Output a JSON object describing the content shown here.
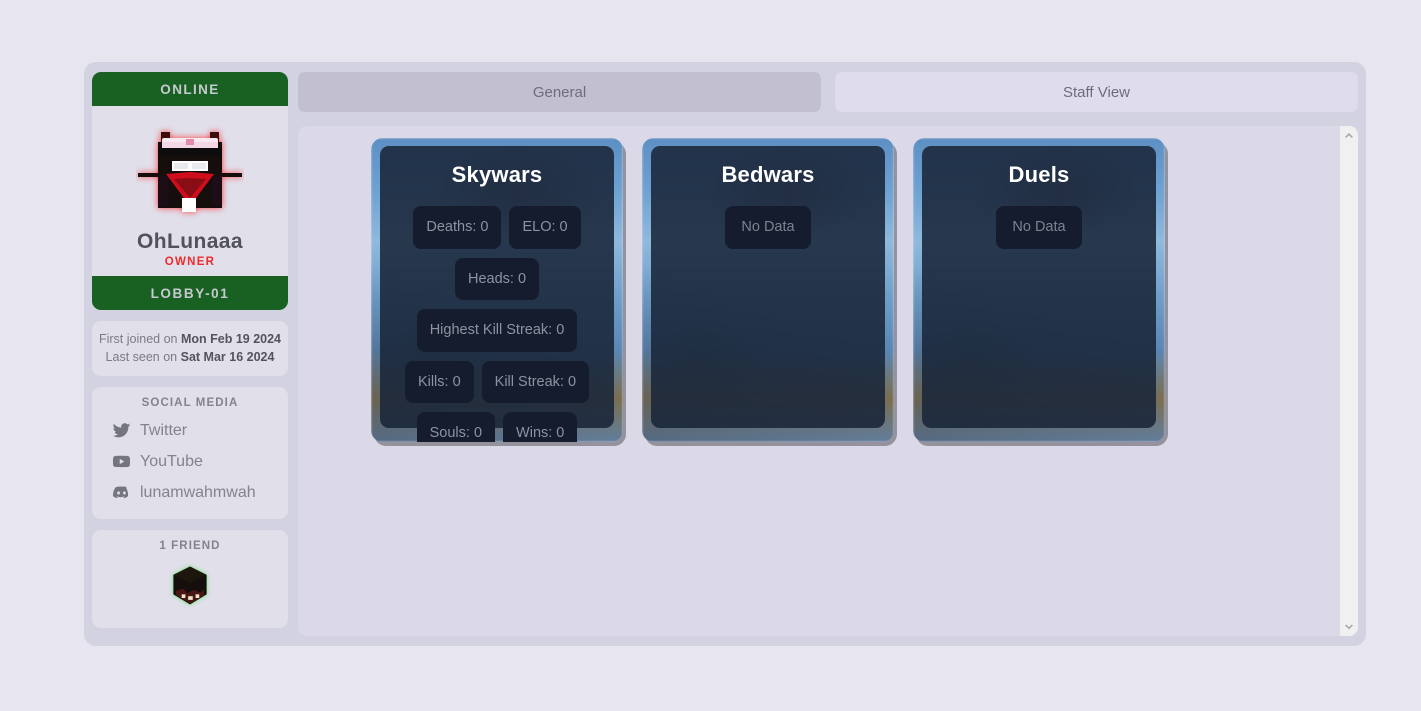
{
  "sidebar": {
    "status": "ONLINE",
    "avatar_name": "player-skin-avatar",
    "username": "OhLunaaa",
    "rank": "OWNER",
    "server": "LOBBY-01",
    "dates": {
      "first_joined_label": "First joined on",
      "first_joined_value": "Mon Feb 19 2024",
      "last_seen_label": "Last seen on",
      "last_seen_value": "Sat Mar 16 2024"
    },
    "social": {
      "title": "SOCIAL MEDIA",
      "items": [
        {
          "icon": "twitter-icon",
          "label": "Twitter"
        },
        {
          "icon": "youtube-icon",
          "label": "YouTube"
        },
        {
          "icon": "discord-icon",
          "label": "lunamwahmwah"
        }
      ]
    },
    "friends": {
      "title": "1 FRIEND",
      "avatars": [
        {
          "name": "friend-avatar"
        }
      ]
    }
  },
  "tabs": [
    {
      "label": "General",
      "active": true
    },
    {
      "label": "Staff View",
      "active": false
    }
  ],
  "cards": [
    {
      "title": "Skywars",
      "has_data": true,
      "stats": [
        "Deaths: 0",
        "ELO: 0",
        "Heads: 0",
        "Highest Kill Streak: 0",
        "Kills: 0",
        "Kill Streak: 0",
        "Souls: 0",
        "Wins: 0"
      ]
    },
    {
      "title": "Bedwars",
      "has_data": false,
      "empty_label": "No Data"
    },
    {
      "title": "Duels",
      "has_data": false,
      "empty_label": "No Data"
    }
  ],
  "colors": {
    "page_background": "#e7e5ef",
    "frame_background": "#d3d2e0",
    "panel_background": "#dbd9e7",
    "status_green": "#186123",
    "rank_red": "#ef2b2b",
    "tab_active": "#c2c0cf",
    "tab_inactive": "#dedced",
    "card_inner": "#192639",
    "stat_badge": "#141c2d"
  },
  "scrollbar": {
    "up_icon": "chevron-up-icon",
    "down_icon": "chevron-down-icon"
  }
}
